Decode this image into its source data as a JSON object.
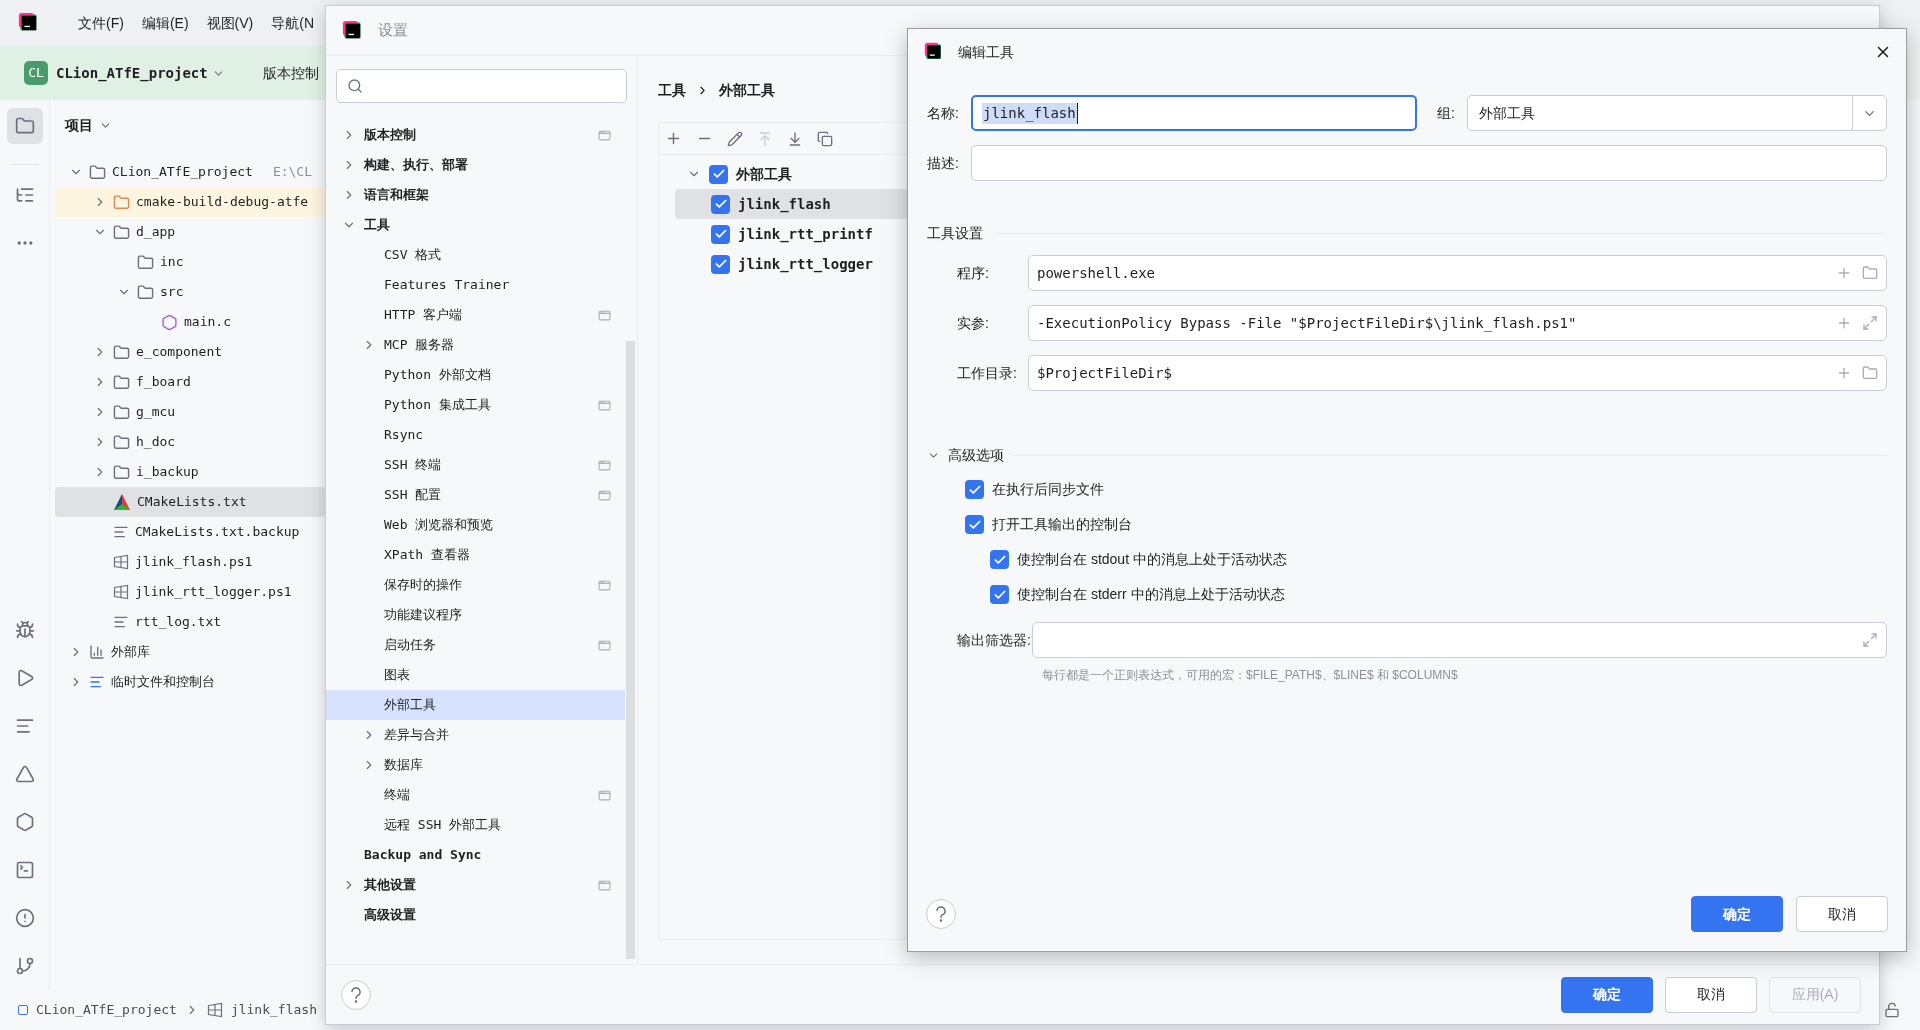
{
  "ide": {
    "menu": [
      "文件(F)",
      "编辑(E)",
      "视图(V)",
      "导航(N"
    ],
    "project_button": {
      "badge": "CL",
      "label": "CLion_ATfE_project"
    },
    "vcs_button": "版本控制",
    "panel_title": "项目",
    "project_tree": [
      {
        "label": "CLion_ATfE_project",
        "kind": "project",
        "note": "E:\\CL",
        "expanded": true,
        "selected": false,
        "children": [
          {
            "label": "cmake-build-debug-atfe",
            "kind": "excluded-folder",
            "expanded": false,
            "selected": false
          },
          {
            "label": "d_app",
            "kind": "folder",
            "expanded": true,
            "selected": false,
            "children": [
              {
                "label": "inc",
                "kind": "folder",
                "selected": false
              },
              {
                "label": "src",
                "kind": "folder",
                "expanded": true,
                "selected": false,
                "children": [
                  {
                    "label": "main.c",
                    "kind": "c",
                    "selected": false
                  }
                ]
              }
            ]
          },
          {
            "label": "e_component",
            "kind": "folder",
            "expanded": false,
            "selected": false
          },
          {
            "label": "f_board",
            "kind": "folder",
            "expanded": false,
            "selected": false
          },
          {
            "label": "g_mcu",
            "kind": "folder",
            "expanded": false,
            "selected": false
          },
          {
            "label": "h_doc",
            "kind": "folder",
            "expanded": false,
            "selected": false
          },
          {
            "label": "i_backup",
            "kind": "folder",
            "expanded": false,
            "selected": false
          },
          {
            "label": "CMakeLists.txt",
            "kind": "cmake",
            "selected": true
          },
          {
            "label": "CMakeLists.txt.backup",
            "kind": "text",
            "selected": false
          },
          {
            "label": "jlink_flash.ps1",
            "kind": "script",
            "selected": false
          },
          {
            "label": "jlink_rtt_logger.ps1",
            "kind": "script",
            "selected": false
          },
          {
            "label": "rtt_log.txt",
            "kind": "text",
            "selected": false
          }
        ]
      },
      {
        "label": "外部库",
        "kind": "library",
        "expanded": false,
        "selected": false
      },
      {
        "label": "临时文件和控制台",
        "kind": "scratch",
        "expanded": false,
        "selected": false
      }
    ],
    "breadcrumbs": [
      "CLion_ATfE_project",
      "jlink_flash"
    ]
  },
  "settings": {
    "title": "设置",
    "tree": [
      {
        "label": "版本控制",
        "kind": "group",
        "expanded": false,
        "project_icon": true,
        "selected": false
      },
      {
        "label": "构建、执行、部署",
        "kind": "group",
        "expanded": false,
        "project_icon": false,
        "selected": false
      },
      {
        "label": "语言和框架",
        "kind": "group",
        "expanded": false,
        "project_icon": false,
        "selected": false
      },
      {
        "label": "工具",
        "kind": "group",
        "expanded": true,
        "project_icon": false,
        "selected": false,
        "children": [
          {
            "label": "CSV 格式",
            "kind": "page",
            "project_icon": false,
            "selected": false
          },
          {
            "label": "Features Trainer",
            "kind": "page",
            "project_icon": false,
            "selected": false
          },
          {
            "label": "HTTP 客户端",
            "kind": "page",
            "project_icon": true,
            "selected": false
          },
          {
            "label": "MCP 服务器",
            "kind": "group",
            "expanded": false,
            "project_icon": false,
            "selected": false
          },
          {
            "label": "Python 外部文档",
            "kind": "page",
            "project_icon": false,
            "selected": false
          },
          {
            "label": "Python 集成工具",
            "kind": "page",
            "project_icon": true,
            "selected": false
          },
          {
            "label": "Rsync",
            "kind": "page",
            "project_icon": false,
            "selected": false
          },
          {
            "label": "SSH 终端",
            "kind": "page",
            "project_icon": true,
            "selected": false
          },
          {
            "label": "SSH 配置",
            "kind": "page",
            "project_icon": true,
            "selected": false
          },
          {
            "label": "Web 浏览器和预览",
            "kind": "page",
            "project_icon": false,
            "selected": false
          },
          {
            "label": "XPath 查看器",
            "kind": "page",
            "project_icon": false,
            "selected": false
          },
          {
            "label": "保存时的操作",
            "kind": "page",
            "project_icon": true,
            "selected": false
          },
          {
            "label": "功能建议程序",
            "kind": "page",
            "project_icon": false,
            "selected": false
          },
          {
            "label": "启动任务",
            "kind": "page",
            "project_icon": true,
            "selected": false
          },
          {
            "label": "图表",
            "kind": "page",
            "project_icon": false,
            "selected": false
          },
          {
            "label": "外部工具",
            "kind": "page",
            "project_icon": false,
            "selected": true
          },
          {
            "label": "差异与合并",
            "kind": "group",
            "expanded": false,
            "project_icon": false,
            "selected": false
          },
          {
            "label": "数据库",
            "kind": "group",
            "expanded": false,
            "project_icon": false,
            "selected": false
          },
          {
            "label": "终端",
            "kind": "page",
            "project_icon": true,
            "selected": false
          },
          {
            "label": "远程 SSH 外部工具",
            "kind": "page",
            "project_icon": false,
            "selected": false
          }
        ]
      },
      {
        "label": "Backup and Sync",
        "kind": "page",
        "project_icon": false,
        "selected": false
      },
      {
        "label": "其他设置",
        "kind": "group",
        "expanded": false,
        "project_icon": true,
        "selected": false
      },
      {
        "label": "高级设置",
        "kind": "page",
        "project_icon": false,
        "selected": false
      }
    ],
    "breadcrumb": [
      "工具",
      "外部工具"
    ],
    "tools": [
      {
        "label": "外部工具",
        "checked": true,
        "expanded": true,
        "selected": false,
        "children": [
          {
            "label": "jlink_flash",
            "checked": true,
            "selected": true
          },
          {
            "label": "jlink_rtt_printf",
            "checked": true,
            "selected": false
          },
          {
            "label": "jlink_rtt_logger",
            "checked": true,
            "selected": false
          }
        ]
      }
    ],
    "buttons": [
      {
        "label": "确定",
        "kind": "primary"
      },
      {
        "label": "取消",
        "kind": "secondary"
      },
      {
        "label": "应用(A)",
        "kind": "disabled"
      }
    ]
  },
  "edit_dialog": {
    "title": "编辑工具",
    "name": {
      "label": "名称:",
      "value": "jlink_flash"
    },
    "group": {
      "label": "组:",
      "value": "外部工具"
    },
    "description": {
      "label": "描述:"
    },
    "tool_settings": {
      "title": "工具设置",
      "fields": [
        {
          "label": "程序:",
          "value": "powershell.exe",
          "kind": "browse"
        },
        {
          "label": "实参:",
          "value": "-ExecutionPolicy Bypass -File \"$ProjectFileDir$\\jlink_flash.ps1\"",
          "kind": "expand"
        },
        {
          "label": "工作目录:",
          "value": "$ProjectFileDir$",
          "kind": "browse"
        }
      ]
    },
    "advanced": {
      "title": "高级选项",
      "expanded": true,
      "options": [
        {
          "label": "在执行后同步文件",
          "checked": true
        },
        {
          "label": "打开工具输出的控制台",
          "checked": true,
          "children": [
            {
              "label": "使控制台在 stdout 中的消息上处于活动状态",
              "checked": true
            },
            {
              "label": "使控制台在 stderr 中的消息上处于活动状态",
              "checked": true
            }
          ]
        }
      ],
      "output_filter": {
        "label": "输出筛选器:",
        "hint": "每行都是一个正则表达式，可用的宏：$FILE_PATH$、$LINE$ 和 $COLUMN$"
      }
    },
    "buttons": [
      {
        "label": "确定",
        "kind": "primary"
      },
      {
        "label": "取消",
        "kind": "secondary"
      }
    ]
  }
}
